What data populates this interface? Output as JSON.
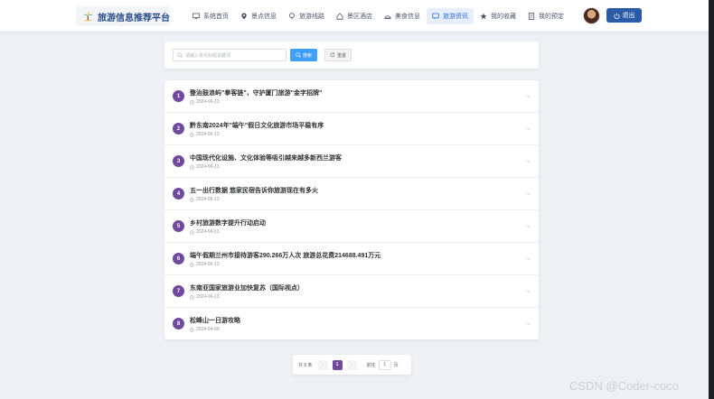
{
  "header": {
    "brand_title": "旅游信息推荐平台",
    "nav": [
      {
        "label": "系统首页",
        "icon": "monitor-icon",
        "active": false
      },
      {
        "label": "景点信息",
        "icon": "location-icon",
        "active": false
      },
      {
        "label": "旅游线路",
        "icon": "route-icon",
        "active": false
      },
      {
        "label": "景区酒店",
        "icon": "house-icon",
        "active": false
      },
      {
        "label": "美食信息",
        "icon": "dish-icon",
        "active": false
      },
      {
        "label": "旅游资讯",
        "icon": "message-icon",
        "active": true
      },
      {
        "label": "我的收藏",
        "icon": "star-icon",
        "active": false
      },
      {
        "label": "我的预定",
        "icon": "document-icon",
        "active": false
      }
    ],
    "logout_label": "退出"
  },
  "search": {
    "placeholder": "请输入资讯标题关键词",
    "search_label": "搜索",
    "reset_label": "重置"
  },
  "news": [
    {
      "num": "1",
      "title": "整治鼓浪屿\"拳客链\"，守护厦门旅游\"金字招牌\"",
      "date": "2024-06-13"
    },
    {
      "num": "2",
      "title": "黔东南2024年\"端午\"假日文化旅游市场平稳有序",
      "date": "2024-06-13"
    },
    {
      "num": "3",
      "title": "中国现代化设施、文化体验等吸引越来越多新西兰游客",
      "date": "2024-06-13"
    },
    {
      "num": "4",
      "title": "五一出行数据 悠家民宿告诉你旅游现在有多火",
      "date": "2024-05-13"
    },
    {
      "num": "5",
      "title": "乡村旅游数字提升行动启动",
      "date": "2024-06-13"
    },
    {
      "num": "6",
      "title": "端午假期兰州市接待游客290.266万人次 旅游总花费214688.491万元",
      "date": "2024-06-13"
    },
    {
      "num": "7",
      "title": "东南亚国家旅游业加快复苏（国际视点）",
      "date": "2024-06-13"
    },
    {
      "num": "8",
      "title": "松峰山一日游攻略",
      "date": "2024-04-09"
    }
  ],
  "pagination": {
    "total": "共 8 条",
    "current": "1",
    "goto_prefix": "前往",
    "goto_value": "1",
    "goto_suffix": "页"
  },
  "watermark": "CSDN @Coder-coco",
  "colors": {
    "accent": "#2b6cd8",
    "badge": "#6f4a9e",
    "logout": "#2b5aa6",
    "search": "#409eff"
  }
}
